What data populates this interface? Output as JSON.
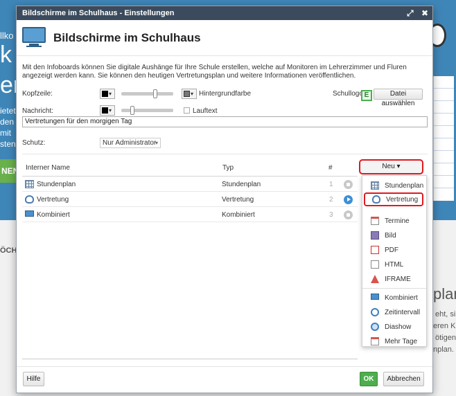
{
  "background": {
    "fragments": [
      "llko",
      "k",
      "en",
      "ietet",
      "den",
      "mit",
      "sten",
      "NEN",
      "ÖCH",
      "plan",
      "eht, sir",
      "eren K",
      "ötigen.",
      "nplan."
    ]
  },
  "modal": {
    "title": "Bildschirme im Schulhaus - Einstellungen",
    "maximize_icon": "⤢",
    "close_icon": "✖",
    "heading": "Bildschirme im Schulhaus",
    "description": "Mit den Infoboards können Sie digitale Aushänge für Ihre Schule erstellen, welche auf Monitoren im Lehrerzimmer und Fluren angezeigt werden kann. Sie können den heutigen Vertretungsplan und weitere Informationen veröffentlichen."
  },
  "settings": {
    "kopfzeile_label": "Kopfzeile:",
    "hintergrundfarbe_label": "Hintergrundfarbe",
    "schullogo_label": "Schullogo:",
    "datei_button": "Datei auswählen",
    "nachricht_label": "Nachricht:",
    "lauftext_label": "Lauftext",
    "nachricht_value": "Vertretungen für den morgigen Tag",
    "schutz_label": "Schutz:",
    "schutz_value": "Nur Administrator"
  },
  "table": {
    "headers": {
      "name": "Interner Name",
      "type": "Typ",
      "number": "#"
    },
    "rows": [
      {
        "name": "Stundenplan",
        "type": "Stundenplan",
        "number": "1",
        "icon": "grid-icon",
        "action": "stop"
      },
      {
        "name": "Vertretung",
        "type": "Vertretung",
        "number": "2",
        "icon": "headset-icon",
        "action": "play"
      },
      {
        "name": "Kombiniert",
        "type": "Kombiniert",
        "number": "3",
        "icon": "monitor-icon",
        "action": "stop"
      }
    ]
  },
  "new_menu": {
    "button_label": "Neu ▾",
    "items": [
      {
        "label": "Stundenplan",
        "icon": "grid-icon",
        "highlighted": false
      },
      {
        "label": "Vertretung",
        "icon": "headset-icon",
        "highlighted": true
      },
      {
        "label": "Termine",
        "icon": "calendar-icon",
        "highlighted": false
      },
      {
        "label": "Bild",
        "icon": "image-icon",
        "highlighted": false
      },
      {
        "label": "PDF",
        "icon": "pdf-icon",
        "highlighted": false
      },
      {
        "label": "HTML",
        "icon": "html-icon",
        "highlighted": false
      },
      {
        "label": "IFRAME",
        "icon": "iframe-icon",
        "highlighted": false
      },
      {
        "label": "Kombiniert",
        "icon": "monitor-icon",
        "highlighted": false
      },
      {
        "label": "Zeitintervall",
        "icon": "clock-icon",
        "highlighted": false
      },
      {
        "label": "Diashow",
        "icon": "slideshow-icon",
        "highlighted": false
      },
      {
        "label": "Mehr Tage",
        "icon": "calendar-icon",
        "highlighted": false
      }
    ]
  },
  "footer": {
    "help_button": "Hilfe",
    "ok_button": "OK",
    "cancel_button": "Abbrechen"
  },
  "colors": {
    "titlebar": "#3b4b5d",
    "highlight": "#e0191f",
    "ok": "#4cae4c",
    "background_blue": "#3f86b8"
  }
}
